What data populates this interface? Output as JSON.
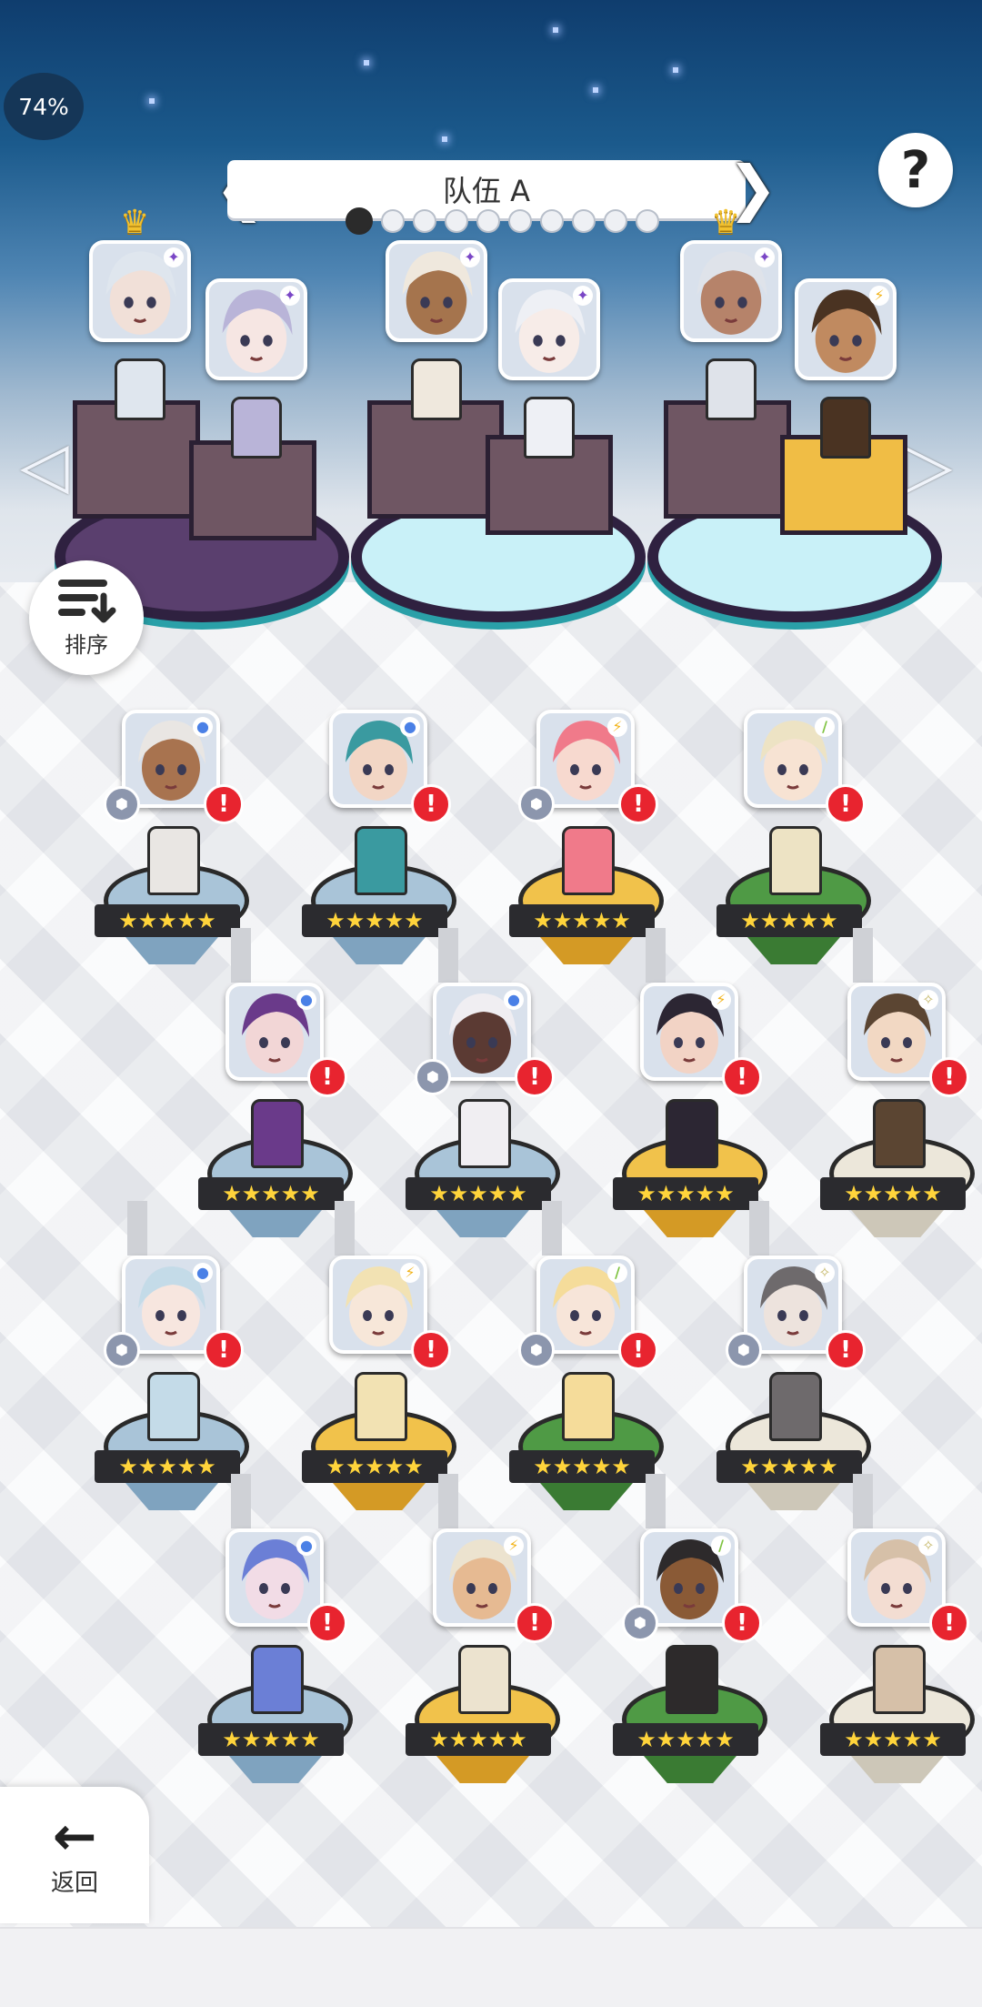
{
  "status": {
    "battery": "74%"
  },
  "header": {
    "team_name": "队伍 A",
    "left_chevron": "❮",
    "right_chevron": "❯",
    "page_dots": 10,
    "active_dot": 0,
    "help_label": "?"
  },
  "side_arrows": {
    "left": "◁",
    "right": "▷"
  },
  "sort_button": {
    "label": "排序"
  },
  "back_button": {
    "label": "返回",
    "icon": "←"
  },
  "stars": "★★★★★",
  "badge": "!",
  "attribute_icons": {
    "water": "●",
    "thunder": "⚡",
    "wind": "/",
    "light": "✧",
    "void": "✦"
  },
  "colors": {
    "pedestal_blue": "#a9c4d8",
    "pedestal_gold": "#f1c24b",
    "pedestal_green": "#4f9a45",
    "pedestal_white": "#ece7da",
    "alert_red": "#e8242f",
    "dark_ring": "#2f2140"
  },
  "team_slots": [
    {
      "element": "void",
      "crown": true,
      "skin": "#f1e0d8",
      "hair": "#dfe6ee"
    },
    {
      "element": "void",
      "crown": false,
      "skin": "#f6e6e3",
      "hair": "#b9b4d8"
    },
    {
      "element": "void",
      "crown": false,
      "skin": "#a5744d",
      "hair": "#efe8dd"
    },
    {
      "element": "void",
      "crown": false,
      "skin": "#f7ece8",
      "hair": "#eef0f5"
    },
    {
      "element": "void",
      "crown": true,
      "skin": "#b6836a",
      "hair": "#dfe3ea"
    },
    {
      "element": "thunder",
      "crown": false,
      "skin": "#c08a60",
      "hair": "#4a3322"
    }
  ],
  "heroes": [
    {
      "element": "water",
      "pedestal": "blue",
      "gem": true,
      "skin": "#a8734f",
      "hair": "#e9e6e3"
    },
    {
      "element": "water",
      "pedestal": "blue",
      "gem": false,
      "skin": "#f2d6c5",
      "hair": "#3a9aa0"
    },
    {
      "element": "thunder",
      "pedestal": "gold",
      "gem": true,
      "skin": "#f7d9cf",
      "hair": "#f07a8a"
    },
    {
      "element": "wind",
      "pedestal": "green",
      "gem": false,
      "skin": "#f7e3d3",
      "hair": "#ede3c4"
    },
    {
      "element": "water",
      "pedestal": "blue",
      "gem": false,
      "skin": "#f2d6d6",
      "hair": "#6a3a8a"
    },
    {
      "element": "water",
      "pedestal": "blue",
      "gem": true,
      "skin": "#5b3a33",
      "hair": "#f0eef2"
    },
    {
      "element": "thunder",
      "pedestal": "gold",
      "gem": false,
      "skin": "#f2d3c5",
      "hair": "#2c2633"
    },
    {
      "element": "light",
      "pedestal": "white",
      "gem": false,
      "skin": "#f2d8c3",
      "hair": "#5b4532"
    },
    {
      "element": "water",
      "pedestal": "blue",
      "gem": true,
      "skin": "#f7e6df",
      "hair": "#c4dbe8"
    },
    {
      "element": "thunder",
      "pedestal": "gold",
      "gem": false,
      "skin": "#f7e7d9",
      "hair": "#f2e2b3"
    },
    {
      "element": "wind",
      "pedestal": "green",
      "gem": true,
      "skin": "#f7e5d9",
      "hair": "#f5dc9a"
    },
    {
      "element": "light",
      "pedestal": "white",
      "gem": true,
      "skin": "#ede3dd",
      "hair": "#6e6a6c"
    },
    {
      "element": "water",
      "pedestal": "blue",
      "gem": false,
      "skin": "#f2dce6",
      "hair": "#6b7fd6"
    },
    {
      "element": "thunder",
      "pedestal": "gold",
      "gem": false,
      "skin": "#e6ba92",
      "hair": "#ece3cf"
    },
    {
      "element": "wind",
      "pedestal": "green",
      "gem": true,
      "skin": "#8a5a36",
      "hair": "#2d2a2b"
    },
    {
      "element": "light",
      "pedestal": "white",
      "gem": false,
      "skin": "#f3ddd2",
      "hair": "#d6c0a8"
    }
  ]
}
